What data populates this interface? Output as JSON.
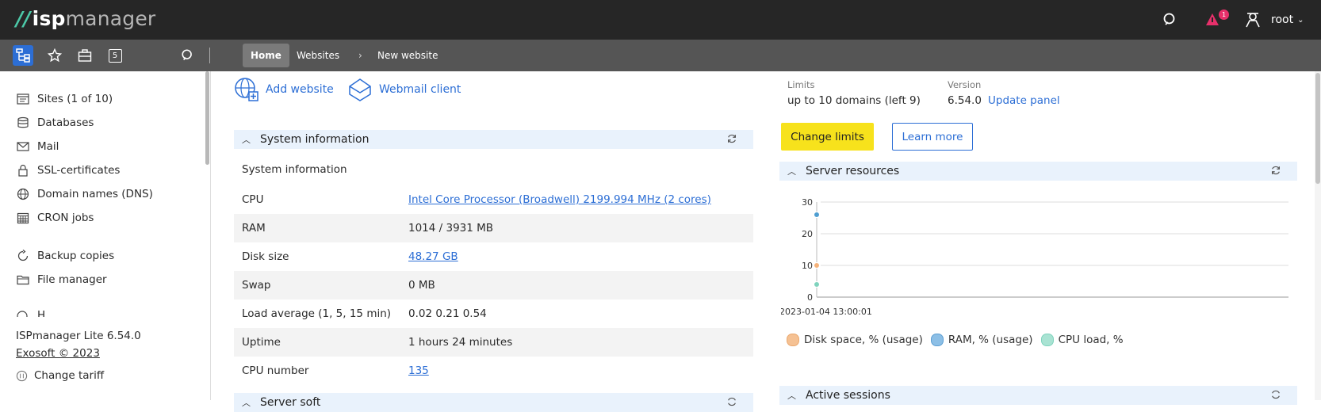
{
  "topbar": {
    "logo_slash": "//",
    "logo_isp": "isp",
    "logo_manager": "manager",
    "notification_count": "1",
    "user": "root"
  },
  "toolbar": {
    "tabs_count": "5",
    "breadcrumbs": [
      "Home",
      "Websites",
      "New website"
    ]
  },
  "sidebar": {
    "items": [
      {
        "label": "Sites (1 of 10)",
        "icon": "sites-icon"
      },
      {
        "label": "Databases",
        "icon": "database-icon"
      },
      {
        "label": "Mail",
        "icon": "mail-icon"
      },
      {
        "label": "SSL-certificates",
        "icon": "lock-icon"
      },
      {
        "label": "Domain names (DNS)",
        "icon": "globe-icon"
      },
      {
        "label": "CRON jobs",
        "icon": "calendar-icon"
      },
      {
        "label": "Backup copies",
        "icon": "backup-icon"
      },
      {
        "label": "File manager",
        "icon": "folder-icon"
      }
    ],
    "cut_item": "H",
    "product": "ISPmanager Lite 6.54.0",
    "copyright": "Exosoft © 2023",
    "change_tariff": "Change tariff"
  },
  "quick_links": {
    "add_website": "Add website",
    "webmail": "Webmail client"
  },
  "system_info": {
    "panel_title": "System information",
    "subtitle": "System information",
    "rows": [
      {
        "label": "CPU",
        "value": "Intel Core Processor (Broadwell) 2199.994 MHz (2 cores)",
        "link": true
      },
      {
        "label": "RAM",
        "value": "1014 / 3931 MB",
        "link": false
      },
      {
        "label": "Disk size",
        "value": "48.27 GB",
        "link": true
      },
      {
        "label": "Swap",
        "value": "0 MB",
        "link": false
      },
      {
        "label": "Load average (1, 5, 15 min)",
        "value": "0.02 0.21 0.54",
        "link": false
      },
      {
        "label": "Uptime",
        "value": "1 hours 24 minutes",
        "link": false
      },
      {
        "label": "CPU number",
        "value": "135",
        "link": true
      }
    ],
    "next_panel_title": "Server soft"
  },
  "limits": {
    "limits_label": "Limits",
    "limits_value": "up to 10 domains (left 9)",
    "version_label": "Version",
    "version_value": "6.54.0",
    "update_link": "Update panel",
    "change_limits": "Change limits",
    "learn_more": "Learn more"
  },
  "server_resources": {
    "panel_title": "Server resources",
    "next_panel_title": "Active sessions"
  },
  "colors": {
    "accent": "#2c6ed5",
    "disk": "#f5b27a",
    "ram": "#6aa8d8",
    "cpu": "#8ed8c4"
  },
  "chart_data": {
    "type": "scatter",
    "x": [
      "2023-01-04 13:00:01"
    ],
    "y_ticks": [
      0,
      10,
      20,
      30
    ],
    "ylim": [
      0,
      30
    ],
    "grid": true,
    "legend_position": "bottom-left",
    "series": [
      {
        "name": "Disk space, % (usage)",
        "values": [
          10
        ],
        "color": "#f5b27a"
      },
      {
        "name": "RAM, % (usage)",
        "values": [
          26
        ],
        "color": "#4f9ed1"
      },
      {
        "name": "CPU load, %",
        "values": [
          4
        ],
        "color": "#7fd3bd"
      }
    ]
  }
}
